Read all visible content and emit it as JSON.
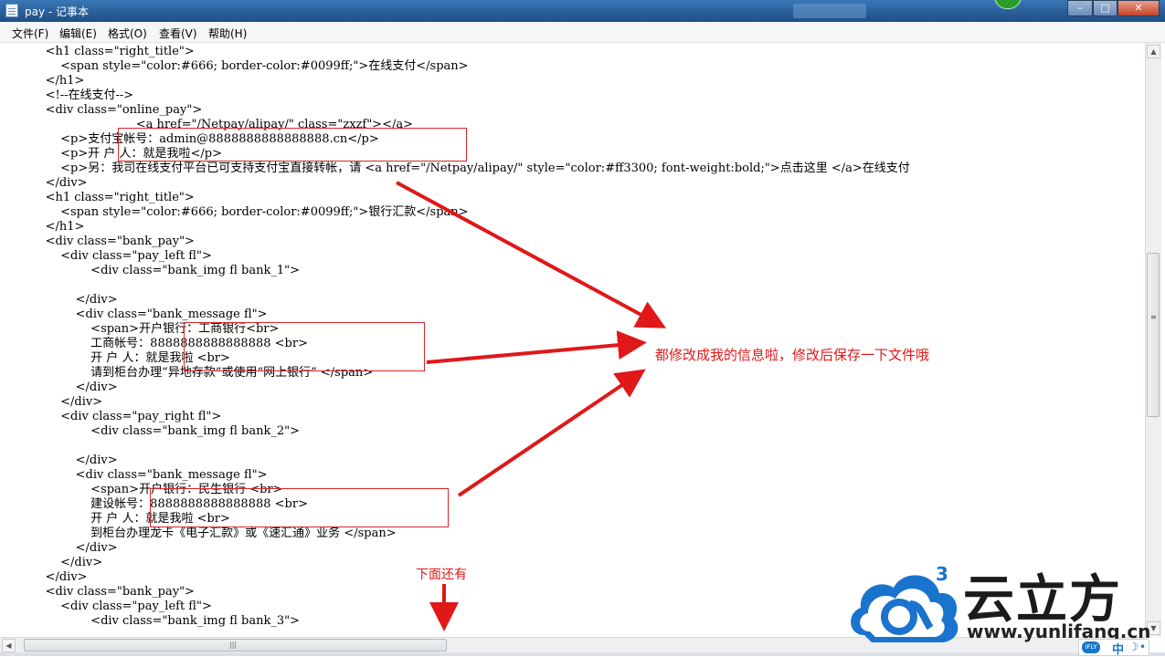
{
  "window": {
    "title": "pay - 记事本"
  },
  "menu": [
    "文件(F)",
    "编辑(E)",
    "格式(O)",
    "查看(V)",
    "帮助(H)"
  ],
  "code_lines": [
    "            <h1 class=\"right_title\">",
    "                <span style=\"color:#666; border-color:#0099ff;\">在线支付</span>",
    "            </h1>",
    "            <!--在线支付-->",
    "            <div class=\"online_pay\">",
    "                                    <a href=\"/Netpay/alipay/\" class=\"zxzf\"></a>",
    "                <p>支付宝帐号：admin@8888888888888888.cn</p>",
    "                <p>开 户 人：就是我啦</p>",
    "                <p>另：我司在线支付平台已可支持支付宝直接转帐，请 <a href=\"/Netpay/alipay/\" style=\"color:#ff3300; font-weight:bold;\">点击这里 </a>在线支付",
    "            </div>",
    "            <h1 class=\"right_title\">",
    "                <span style=\"color:#666; border-color:#0099ff;\">银行汇款</span>",
    "            </h1>",
    "            <div class=\"bank_pay\">",
    "                <div class=\"pay_left fl\">",
    "                        <div class=\"bank_img fl bank_1\">",
    "",
    "                    </div>",
    "                    <div class=\"bank_message fl\">",
    "                        <span>开户银行：工商银行<br>",
    "                        工商帐号：8888888888888888 <br>",
    "                        开 户 人：就是我啦 <br>",
    "                        请到柜台办理“异地存款”或使用“网上银行” </span>",
    "                    </div>",
    "                </div>",
    "                <div class=\"pay_right fl\">",
    "                        <div class=\"bank_img fl bank_2\">",
    "",
    "                    </div>",
    "                    <div class=\"bank_message fl\">",
    "                        <span>开户银行：民生银行 <br>",
    "                        建设帐号：8888888888888888 <br>",
    "                        开 户 人：就是我啦 <br>",
    "                        到柜台办理龙卡《电子汇款》或《速汇通》业务 </span>",
    "                    </div>",
    "                </div>",
    "            </div>",
    "            <div class=\"bank_pay\">",
    "                <div class=\"pay_left fl\">",
    "                        <div class=\"bank_img fl bank_3\">"
  ],
  "annotations": {
    "main": "都修改成我的信息啦，修改后保存一下文件哦",
    "more_below": "下面还有",
    "color": "#e01818"
  },
  "watermark": {
    "superscript": "3",
    "cn_name": "云立方",
    "url": "www.yunlifang.cn"
  },
  "ime": {
    "brand": "iFLY",
    "lang": "中",
    "moon": "☽",
    "punct": "•"
  },
  "titlebar_buttons": {
    "minimize": "–",
    "maximize": "□",
    "close": "✕"
  }
}
